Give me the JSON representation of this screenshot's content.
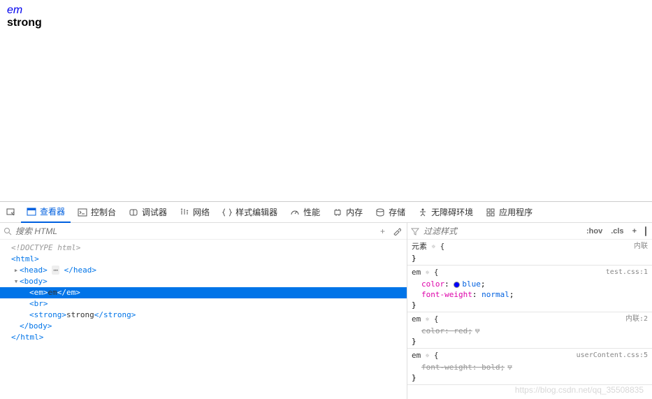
{
  "page": {
    "em_text": "em",
    "strong_text": "strong"
  },
  "tabs": {
    "inspector": "查看器",
    "console": "控制台",
    "debugger": "调试器",
    "network": "网络",
    "style_editor": "样式编辑器",
    "performance": "性能",
    "memory": "内存",
    "storage": "存储",
    "accessibility": "无障碍环境",
    "application": "应用程序"
  },
  "dom": {
    "search_placeholder": "搜索 HTML",
    "doctype": "<!DOCTYPE html>",
    "html_open": "<html>",
    "head_open": "<head>",
    "head_close": "</head>",
    "body_open": "<body>",
    "em_open": "<em>",
    "em_text": "em",
    "em_close": "</em>",
    "br": "<br>",
    "strong_open": "<strong>",
    "strong_text": "strong",
    "strong_close": "</strong>",
    "body_close": "</body>",
    "html_close": "</html>",
    "ellipsis": "⋯"
  },
  "styles": {
    "filter_placeholder": "过滤样式",
    "hov": ":hov",
    "cls": ".cls",
    "element_label": "元素",
    "brace_open": "{",
    "brace_close": "}",
    "rules": [
      {
        "selector": "em",
        "src": "test.css:1",
        "props": [
          {
            "name": "color",
            "value": "blue",
            "swatch": true,
            "strike": false
          },
          {
            "name": "font-weight",
            "value": "normal",
            "strike": false
          }
        ]
      },
      {
        "selector": "em",
        "src": "内联:2",
        "props": [
          {
            "name": "color",
            "value": "red",
            "strike": true,
            "funnel": true
          }
        ]
      },
      {
        "selector": "em",
        "src": "userContent.css:5",
        "props": [
          {
            "name": "font-weight",
            "value": "bold",
            "strike": true,
            "funnel": true
          }
        ]
      }
    ],
    "inline_label": "内联"
  },
  "watermark": "https://blog.csdn.net/qq_35508835"
}
